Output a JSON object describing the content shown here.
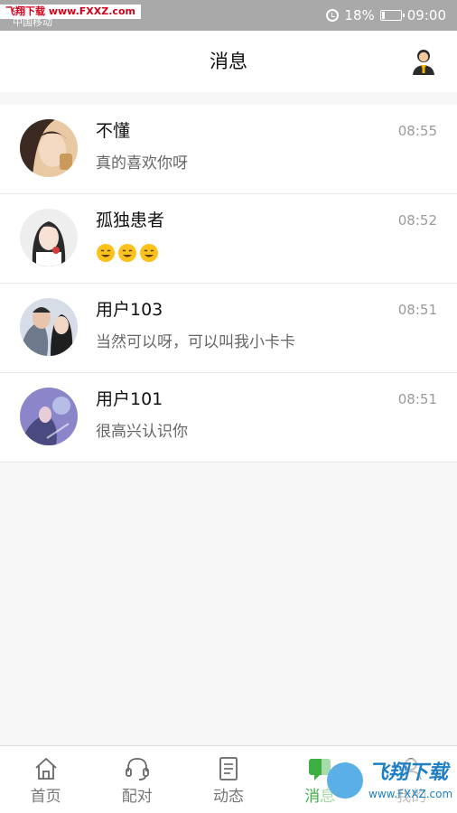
{
  "status_bar": {
    "watermark": "飞翔下载 www.FXXZ.com",
    "carrier": "中国移动",
    "battery": "18%",
    "battery_level": 0.18,
    "time": "09:00"
  },
  "header": {
    "title": "消息"
  },
  "messages": [
    {
      "name": "不懂",
      "preview": "真的喜欢你呀",
      "time": "08:55",
      "avatar": "avatar-photo"
    },
    {
      "name": "孤独患者",
      "preview": "",
      "emoji_count": 3,
      "emoji": "grinning-face-icon",
      "time": "08:52",
      "avatar": "avatar-photo"
    },
    {
      "name": "用户103",
      "preview": "当然可以呀，可以叫我小卡卡",
      "time": "08:51",
      "avatar": "avatar-photo"
    },
    {
      "name": "用户101",
      "preview": "很高兴认识你",
      "time": "08:51",
      "avatar": "avatar-photo"
    }
  ],
  "bottom_nav": {
    "items": [
      {
        "label": "首页",
        "icon": "home-icon",
        "active": false
      },
      {
        "label": "配对",
        "icon": "headset-icon",
        "active": false
      },
      {
        "label": "动态",
        "icon": "document-icon",
        "active": false
      },
      {
        "label": "消息",
        "icon": "message-icon",
        "active": true
      },
      {
        "label": "我的",
        "icon": "person-icon",
        "active": false
      }
    ],
    "active_color": "#3cb043"
  },
  "watermark_bottom": {
    "brand": "飞翔下载",
    "url": "www.FXXZ.com"
  }
}
